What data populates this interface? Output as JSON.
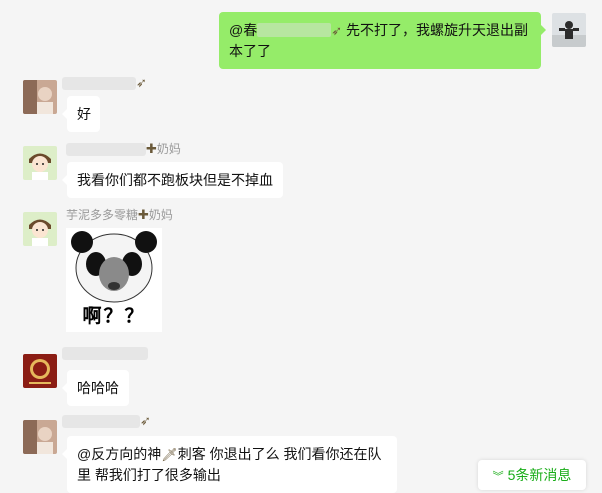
{
  "messages": {
    "m1": {
      "prefix": "@",
      "prefix_tail": "春",
      "text_line1": "先不打了，我螺旋升天退出副",
      "text_line2": "本了了"
    },
    "m3": {
      "text": "好"
    },
    "m4": {
      "nick_suffix": "奶妈",
      "text": "我看你们都不跑板块但是不掉血"
    },
    "m5": {
      "nick": "芋泥多多零糖",
      "nick_suffix": "奶妈",
      "sticker_text": "啊？？"
    },
    "m6": {
      "text": "哈哈哈"
    },
    "m7": {
      "line1_a": "@反方向的神",
      "line1_b": "刺客 你退出了么  我们看你还在队",
      "line2": "里 帮我们打了很多输出"
    }
  },
  "new_messages_label": "5条新消息",
  "icons": {
    "bow": "bow-arrow-icon",
    "cross": "cross-icon",
    "sword": "sword-icon",
    "chevron": "double-chevron-down-icon"
  },
  "colors": {
    "my_bubble": "#95ec69",
    "other_bubble": "#ffffff",
    "background": "#f5f5f5",
    "accent": "#1aad19"
  }
}
